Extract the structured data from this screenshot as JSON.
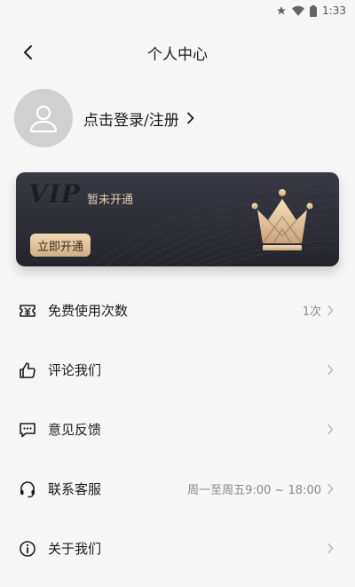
{
  "status_bar": {
    "time": "1:33",
    "icons": [
      "star-icon",
      "wifi-icon",
      "battery-icon"
    ]
  },
  "header": {
    "title": "个人中心",
    "back_icon": "chevron-left-icon"
  },
  "profile": {
    "login_text": "点击登录/注册",
    "avatar_icon": "user-icon"
  },
  "vip": {
    "logo": "VIP",
    "status": "暂未开通",
    "activate_label": "立即开通",
    "icon": "crown-icon",
    "colors": {
      "card_top": "#3a3a45",
      "card_bottom": "#24242c",
      "gold_light": "#f1d8b2",
      "gold_dark": "#cfae84"
    }
  },
  "menu": {
    "items": [
      {
        "label": "免费使用次数",
        "value": "1次",
        "icon": "ticket-icon"
      },
      {
        "label": "评论我们",
        "value": "",
        "icon": "thumbs-up-icon"
      },
      {
        "label": "意见反馈",
        "value": "",
        "icon": "chat-bubble-icon"
      },
      {
        "label": "联系客服",
        "value": "周一至周五9:00 ~ 18:00",
        "icon": "headset-icon"
      },
      {
        "label": "关于我们",
        "value": "",
        "icon": "info-icon"
      }
    ]
  }
}
